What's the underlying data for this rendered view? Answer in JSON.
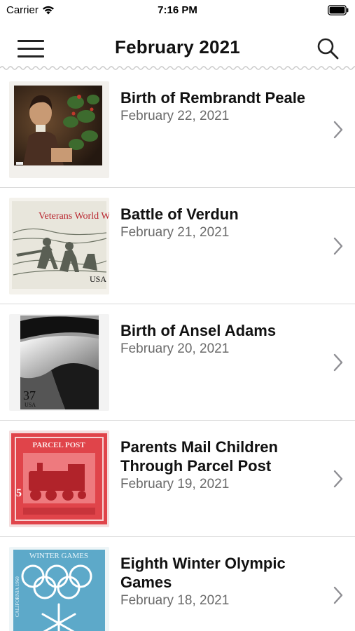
{
  "status": {
    "carrier": "Carrier",
    "time": "7:16 PM"
  },
  "nav": {
    "title": "February 2021",
    "menu_icon": "hamburger-menu-icon",
    "search_icon": "search-icon"
  },
  "items": [
    {
      "title": "Birth of Rembrandt Peale",
      "date": "February 22, 2021",
      "stamp_text": ""
    },
    {
      "title": "Battle of Verdun",
      "date": "February 21, 2021",
      "stamp_text": "Veterans World W",
      "stamp_value": "USA"
    },
    {
      "title": "Birth of Ansel Adams",
      "date": "February 20, 2021",
      "stamp_value": "37",
      "stamp_country": "USA"
    },
    {
      "title": "Parents Mail Children Through Parcel Post",
      "date": "February 19, 2021",
      "stamp_text": "PARCEL POST",
      "stamp_value": "5"
    },
    {
      "title": "Eighth Winter Olympic Games",
      "date": "February 18, 2021",
      "stamp_text": "WINTER GAMES",
      "stamp_country": "CALIFORNIA 1960"
    }
  ],
  "colors": {
    "divider": "#d9d9d9",
    "date_text": "#6b6b6b",
    "chevron": "#8e8e93",
    "parcel_red": "#e0444a",
    "olympic_blue": "#5da9c9"
  }
}
